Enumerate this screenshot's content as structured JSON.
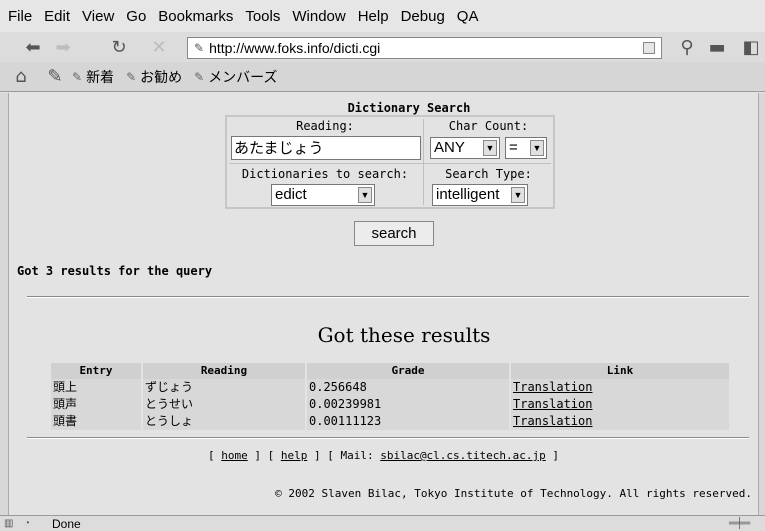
{
  "menubar": {
    "items": [
      "File",
      "Edit",
      "View",
      "Go",
      "Bookmarks",
      "Tools",
      "Window",
      "Help",
      "Debug",
      "QA"
    ]
  },
  "navbar": {
    "url": "http://www.foks.info/dicti.cgi"
  },
  "personal": {
    "items": [
      "新着",
      "お勧め",
      "メンバーズ"
    ]
  },
  "form": {
    "title": "Dictionary Search",
    "reading_label": "Reading:",
    "reading_value": "あたまじょう",
    "charcount_label": "Char Count:",
    "charcount_value": "ANY",
    "charcount_op": "=",
    "dicts_label": "Dictionaries to search:",
    "dicts_value": "edict",
    "searchtype_label": "Search Type:",
    "searchtype_value": "intelligent",
    "search_button": "search"
  },
  "results": {
    "count_text": "Got 3 results for the query",
    "heading": "Got these results",
    "columns": [
      "Entry",
      "Reading",
      "Grade",
      "Link"
    ],
    "rows": [
      {
        "entry": "頭上",
        "reading": "ずじょう",
        "grade": "0.256648",
        "link": "Translation"
      },
      {
        "entry": "頭声",
        "reading": "とうせい",
        "grade": "0.00239981",
        "link": "Translation"
      },
      {
        "entry": "頭書",
        "reading": "とうしょ",
        "grade": "0.00111123",
        "link": "Translation"
      }
    ]
  },
  "footer": {
    "home": "home",
    "help": "help",
    "mail_label": "Mail:",
    "mail": "sbilac@cl.cs.titech.ac.jp",
    "copyright": "© 2002 Slaven Bilac, Tokyo Institute of Technology. All rights reserved."
  },
  "status": {
    "text": "Done"
  }
}
